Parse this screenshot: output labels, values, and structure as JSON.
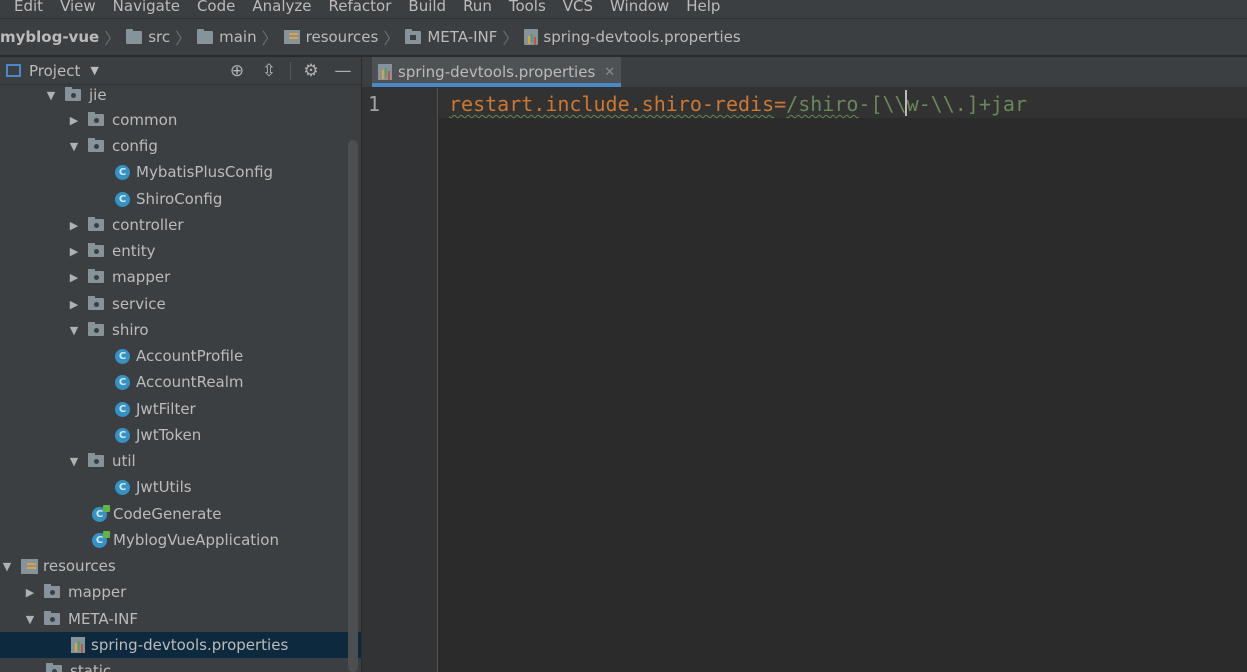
{
  "menu": [
    "Edit",
    "View",
    "Navigate",
    "Code",
    "Analyze",
    "Refactor",
    "Build",
    "Run",
    "Tools",
    "VCS",
    "Window",
    "Help"
  ],
  "breadcrumb": {
    "project": "myblog-vue",
    "items": [
      "src",
      "main",
      "resources",
      "META-INF",
      "spring-devtools.properties"
    ]
  },
  "project_panel": {
    "title": "Project"
  },
  "tree": [
    {
      "label": "jie",
      "type": "package",
      "expanded": true
    },
    {
      "label": "common",
      "type": "package",
      "expanded": false
    },
    {
      "label": "config",
      "type": "package",
      "expanded": true
    },
    {
      "label": "MybatisPlusConfig",
      "type": "class"
    },
    {
      "label": "ShiroConfig",
      "type": "class"
    },
    {
      "label": "controller",
      "type": "package",
      "expanded": false
    },
    {
      "label": "entity",
      "type": "package",
      "expanded": false
    },
    {
      "label": "mapper",
      "type": "package",
      "expanded": false
    },
    {
      "label": "service",
      "type": "package",
      "expanded": false
    },
    {
      "label": "shiro",
      "type": "package",
      "expanded": true
    },
    {
      "label": "AccountProfile",
      "type": "class"
    },
    {
      "label": "AccountRealm",
      "type": "class"
    },
    {
      "label": "JwtFilter",
      "type": "class"
    },
    {
      "label": "JwtToken",
      "type": "class"
    },
    {
      "label": "util",
      "type": "package",
      "expanded": true
    },
    {
      "label": "JwtUtils",
      "type": "class"
    },
    {
      "label": "CodeGenerate",
      "type": "class-runnable"
    },
    {
      "label": "MyblogVueApplication",
      "type": "class-app"
    },
    {
      "label": "resources",
      "type": "resources",
      "expanded": true
    },
    {
      "label": "mapper",
      "type": "folder",
      "expanded": false
    },
    {
      "label": "META-INF",
      "type": "folder",
      "expanded": true
    },
    {
      "label": "spring-devtools.properties",
      "type": "properties",
      "selected": true
    },
    {
      "label": "static",
      "type": "folder"
    }
  ],
  "editor": {
    "tab_label": "spring-devtools.properties",
    "line_number": "1",
    "code_key": "restart.include.shiro-redis",
    "code_eq": "=",
    "code_value_a": "/shi",
    "code_value_b": "ro",
    "code_value_c": "-[\\\\w-\\\\.]+jar"
  },
  "colors": {
    "key": "#cc7832",
    "value": "#6a8759",
    "selection": "#0d293e",
    "tab_underline": "#4a88c7"
  }
}
